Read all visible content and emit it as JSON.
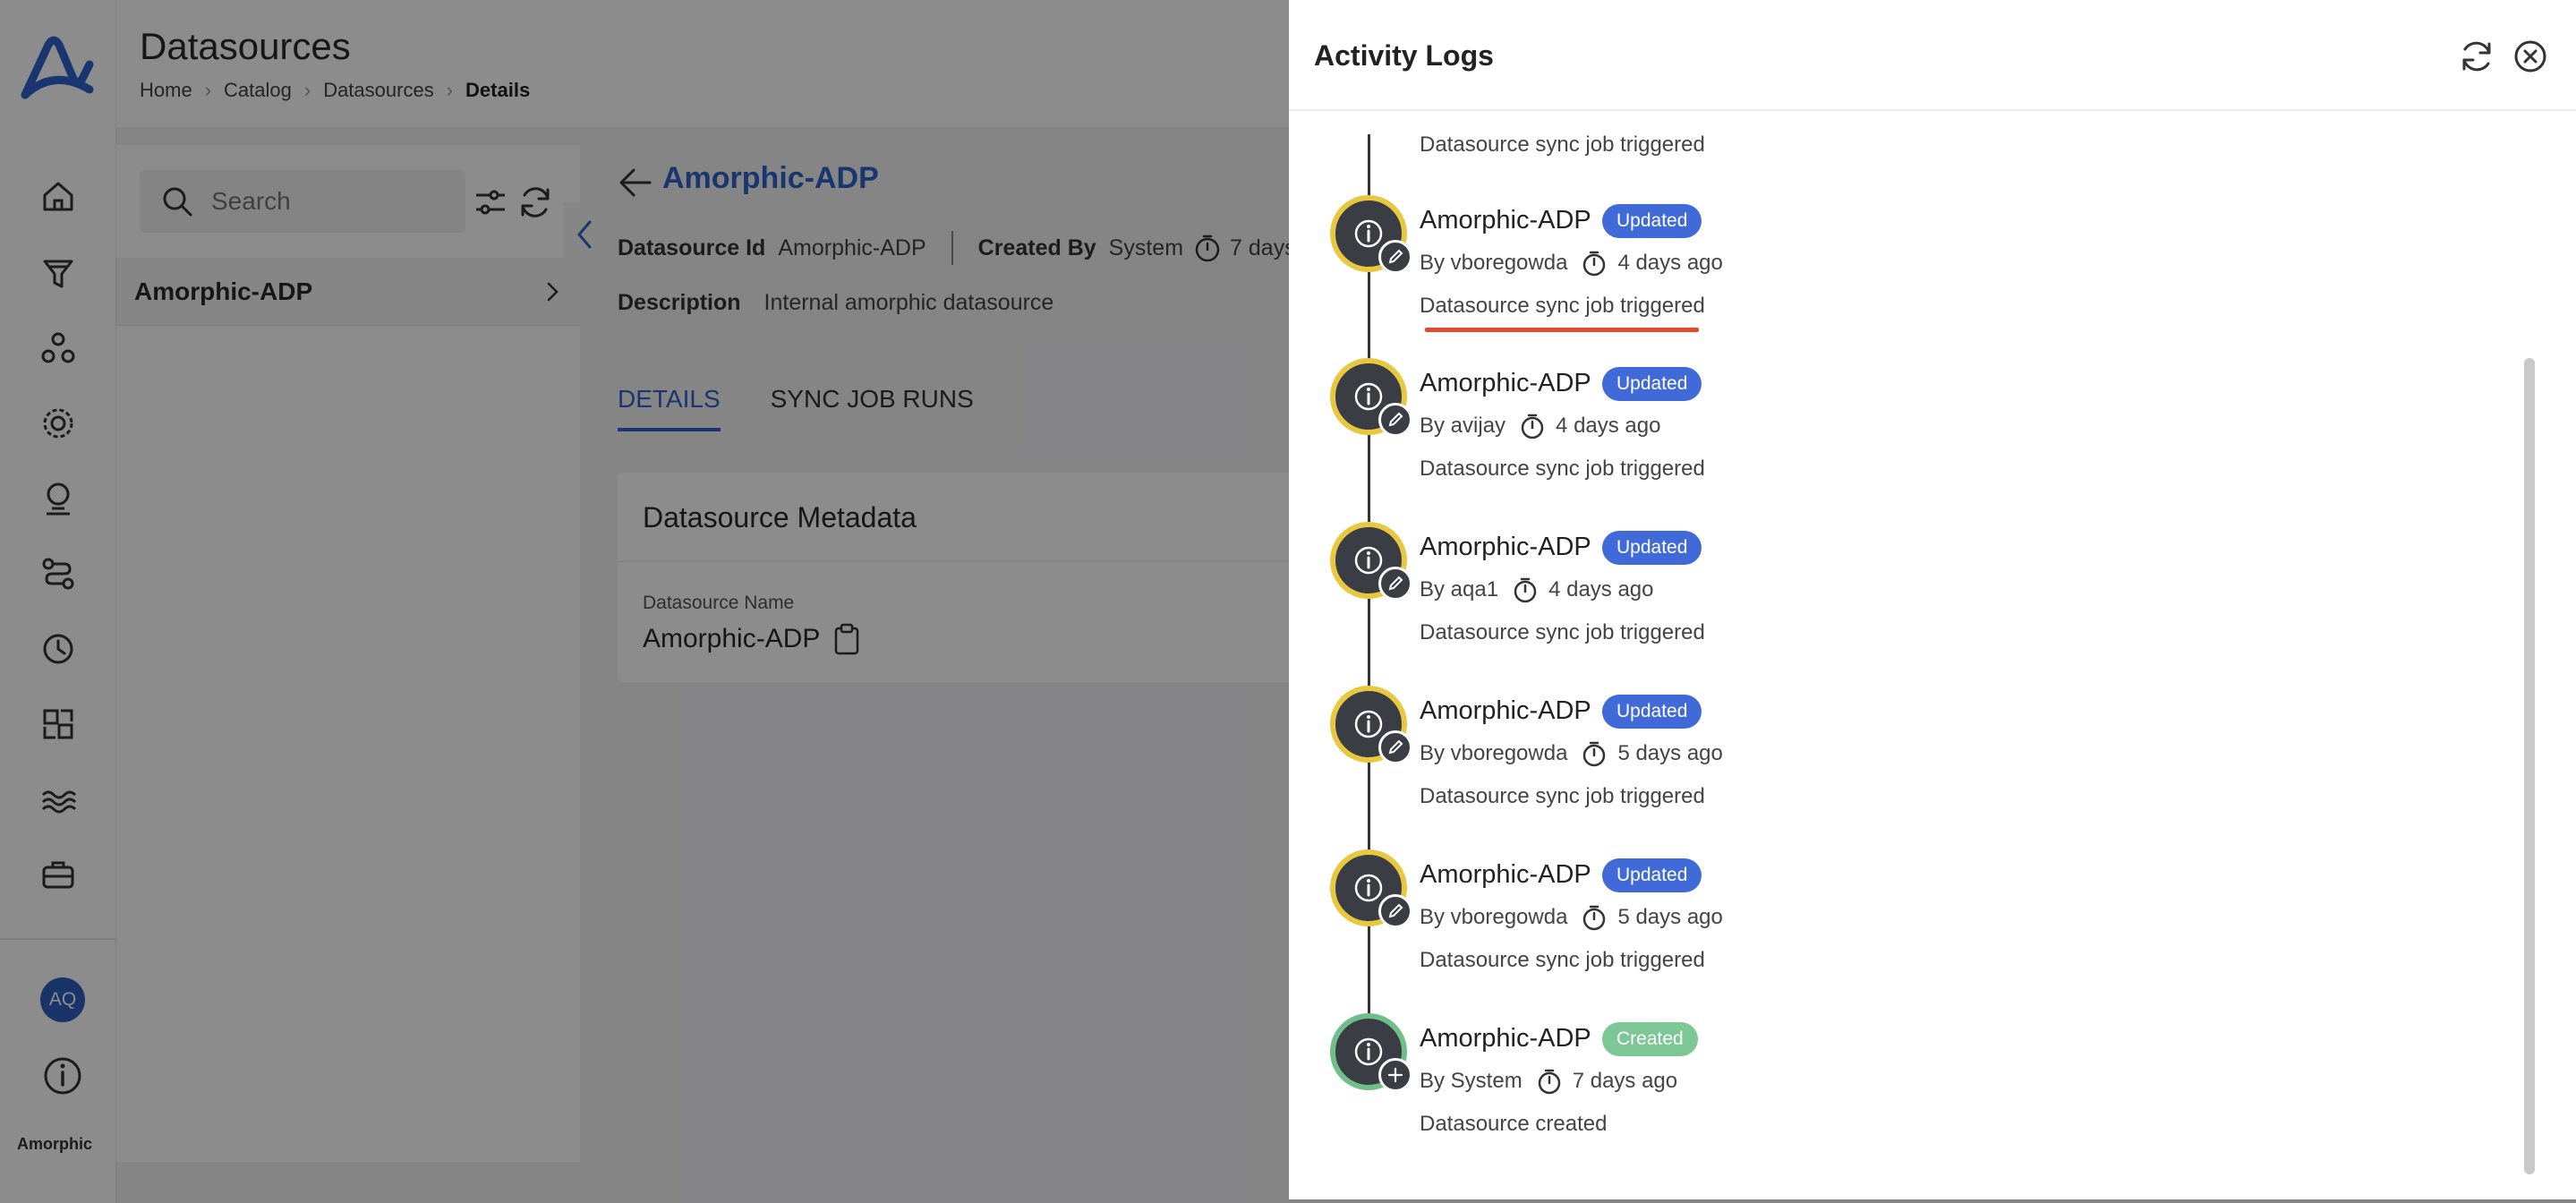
{
  "app": {
    "title": "Datasources",
    "brand": "Amorphic",
    "user_initials": "AQ"
  },
  "breadcrumb": [
    "Home",
    "Catalog",
    "Datasources",
    "Details"
  ],
  "list_panel": {
    "search_placeholder": "Search",
    "items": [
      "Amorphic-ADP"
    ]
  },
  "detail": {
    "name": "Amorphic-ADP",
    "datasource_id_label": "Datasource Id",
    "datasource_id": "Amorphic-ADP",
    "created_by_label": "Created By",
    "created_by": "System",
    "created_ago": "7 days",
    "description_label": "Description",
    "description": "Internal amorphic datasource",
    "tabs": [
      {
        "label": "DETAILS",
        "active": true
      },
      {
        "label": "SYNC JOB RUNS",
        "active": false
      }
    ],
    "metadata_card": {
      "title": "Datasource Metadata",
      "field_label": "Datasource Name",
      "field_value": "Amorphic-ADP"
    }
  },
  "activity_logs": {
    "title": "Activity Logs",
    "top_partial_message": "Datasource sync job triggered",
    "entries": [
      {
        "name": "Amorphic-ADP",
        "status": "Updated",
        "by": "By vboregowda",
        "ago": "4 days ago",
        "message": "Datasource sync job triggered"
      },
      {
        "name": "Amorphic-ADP",
        "status": "Updated",
        "by": "By avijay",
        "ago": "4 days ago",
        "message": "Datasource sync job triggered"
      },
      {
        "name": "Amorphic-ADP",
        "status": "Updated",
        "by": "By aqa1",
        "ago": "4 days ago",
        "message": "Datasource sync job triggered"
      },
      {
        "name": "Amorphic-ADP",
        "status": "Updated",
        "by": "By vboregowda",
        "ago": "5 days ago",
        "message": "Datasource sync job triggered"
      },
      {
        "name": "Amorphic-ADP",
        "status": "Updated",
        "by": "By vboregowda",
        "ago": "5 days ago",
        "message": "Datasource sync job triggered"
      },
      {
        "name": "Amorphic-ADP",
        "status": "Created",
        "by": "By System",
        "ago": "7 days ago",
        "message": "Datasource created"
      }
    ]
  },
  "colors": {
    "accent": "#2f63c9",
    "updated_badge": "#3f6ad8",
    "created_badge": "#7cc794",
    "ring_updated": "#e8c840",
    "ring_created": "#6fbf8a",
    "highlight": "#e64a2e"
  }
}
